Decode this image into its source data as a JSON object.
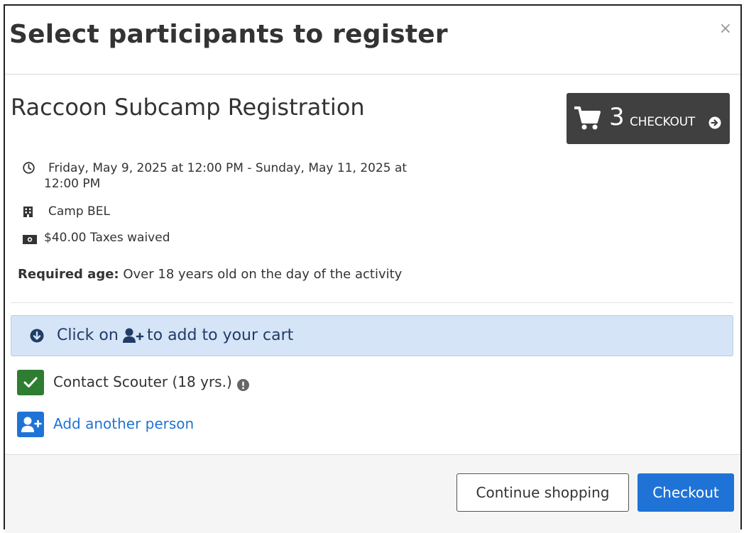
{
  "modal": {
    "title": "Select participants to register",
    "close_glyph": "×"
  },
  "activity": {
    "title": "Raccoon Subcamp Registration",
    "date_line1": "Friday, May 9, 2025 at 12:00 PM - Sunday, May 11, 2025 at",
    "date_line2": "12:00 PM",
    "location": "Camp BEL",
    "price": "$40.00 Taxes waived",
    "required_age_label": "Required age:",
    "required_age_value": " Over 18 years old on the day of the activity"
  },
  "cart": {
    "count": "3",
    "label": "CHECKOUT"
  },
  "alert": {
    "text_before": "Click on",
    "text_after": "to add to your cart"
  },
  "participants": [
    {
      "name": "Contact Scouter (18 yrs.)",
      "checked": true
    }
  ],
  "add_person_label": "Add another person",
  "footer": {
    "continue_label": "Continue shopping",
    "checkout_label": "Checkout"
  },
  "colors": {
    "checkout_bg": "#404040",
    "alert_bg": "#d6e4f7",
    "success": "#2e7d32",
    "primary": "#1f73d6"
  },
  "icons": {
    "clock": "clock-icon",
    "building": "building-icon",
    "money": "money-icon",
    "cart": "cart-icon",
    "arrow": "arrow-circle-right-icon",
    "alert": "arrow-circle-down-icon",
    "person_add": "user-plus-icon",
    "check": "check-icon",
    "info": "info-circle-icon"
  }
}
